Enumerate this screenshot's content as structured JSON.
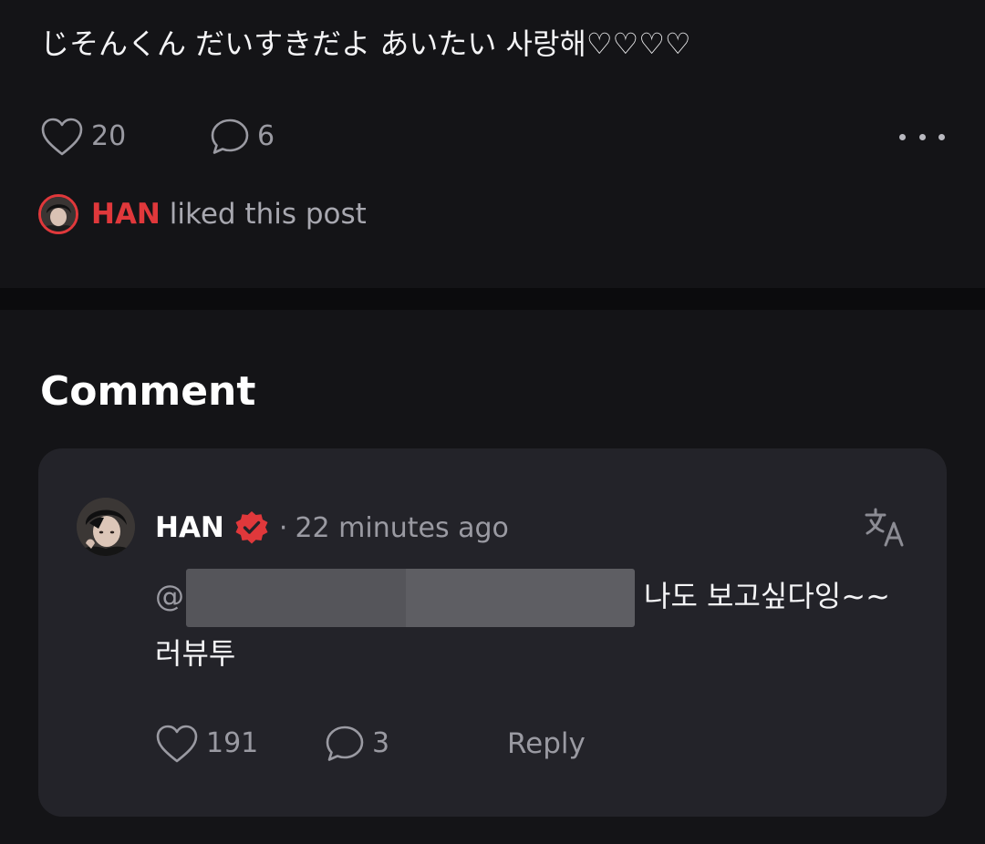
{
  "post": {
    "text": "じそんくん だいすきだよ あいたい 사랑해♡♡♡♡",
    "like_count": "20",
    "comment_count": "6",
    "liked_by": {
      "name": "HAN",
      "suffix": " liked this post"
    }
  },
  "comments": {
    "section_title": "Comment",
    "item": {
      "author": "HAN",
      "separator": "·",
      "time": "22 minutes ago",
      "mention_prefix": "@",
      "text": "나도 보고싶다잉~~ 러뷰투",
      "like_count": "191",
      "reply_count": "3",
      "reply_label": "Reply"
    }
  },
  "colors": {
    "background": "#141417",
    "card": "#232329",
    "accent_red": "#e0383b",
    "muted_text": "#9a9aa2"
  },
  "icons": {
    "like": "heart-outline-icon",
    "comment": "speech-bubble-icon",
    "more": "more-horizontal-icon",
    "verified": "verified-badge-icon",
    "translate": "translate-icon"
  }
}
